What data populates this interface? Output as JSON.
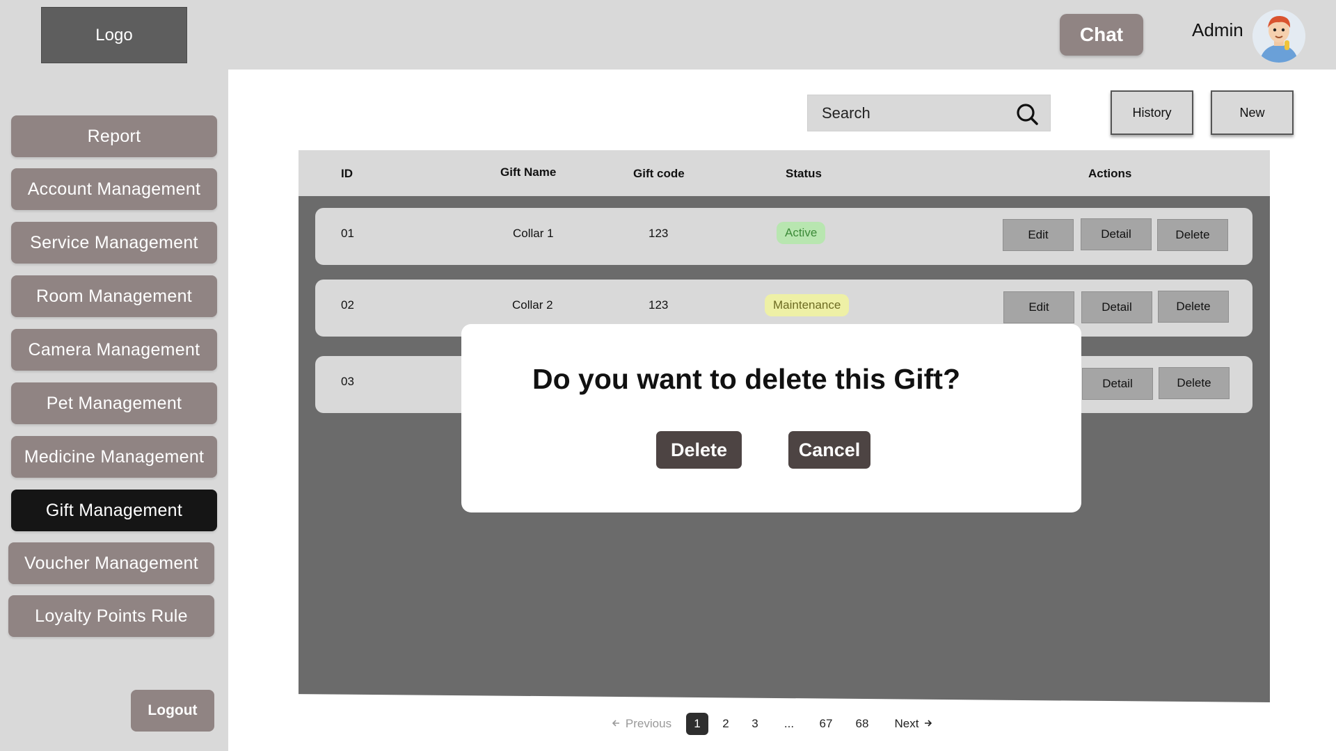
{
  "header": {
    "logo_label": "Logo",
    "chat_label": "Chat",
    "admin_label": "Admin"
  },
  "sidebar": {
    "items": [
      {
        "label": "Report"
      },
      {
        "label": "Account Management"
      },
      {
        "label": "Service Management"
      },
      {
        "label": "Room Management"
      },
      {
        "label": "Camera Management"
      },
      {
        "label": "Pet Management"
      },
      {
        "label": "Medicine Management"
      },
      {
        "label": "Gift Management",
        "active": true
      },
      {
        "label": "Voucher Management"
      },
      {
        "label": "Loyalty Points Rule"
      }
    ],
    "logout_label": "Logout"
  },
  "toolbar": {
    "search_placeholder": "Search",
    "history_label": "History",
    "new_label": "New"
  },
  "table": {
    "headers": {
      "id": "ID",
      "gift_name": "Gift Name",
      "gift_code": "Gift code",
      "status": "Status",
      "actions": "Actions"
    },
    "rows": [
      {
        "id": "01",
        "gift_name": "Collar 1",
        "gift_code": "123",
        "status": "Active"
      },
      {
        "id": "02",
        "gift_name": "Collar 2",
        "gift_code": "123",
        "status": "Maintenance"
      },
      {
        "id": "03",
        "gift_name": "",
        "gift_code": "",
        "status": ""
      }
    ],
    "action_labels": {
      "edit": "Edit",
      "detail": "Detail",
      "delete": "Delete"
    }
  },
  "modal": {
    "title": "Do you want to delete this Gift?",
    "confirm_label": "Delete",
    "cancel_label": "Cancel"
  },
  "pagination": {
    "previous_label": "Previous",
    "next_label": "Next",
    "pages": [
      "1",
      "2",
      "3",
      "...",
      "67",
      "68"
    ],
    "current": "1"
  },
  "colors": {
    "sidebar_button": "#908483",
    "sidebar_active": "#151515",
    "status_active_bg": "#b8e6b0",
    "status_maintenance_bg": "#eef0a6",
    "modal_button": "#4d4443"
  }
}
